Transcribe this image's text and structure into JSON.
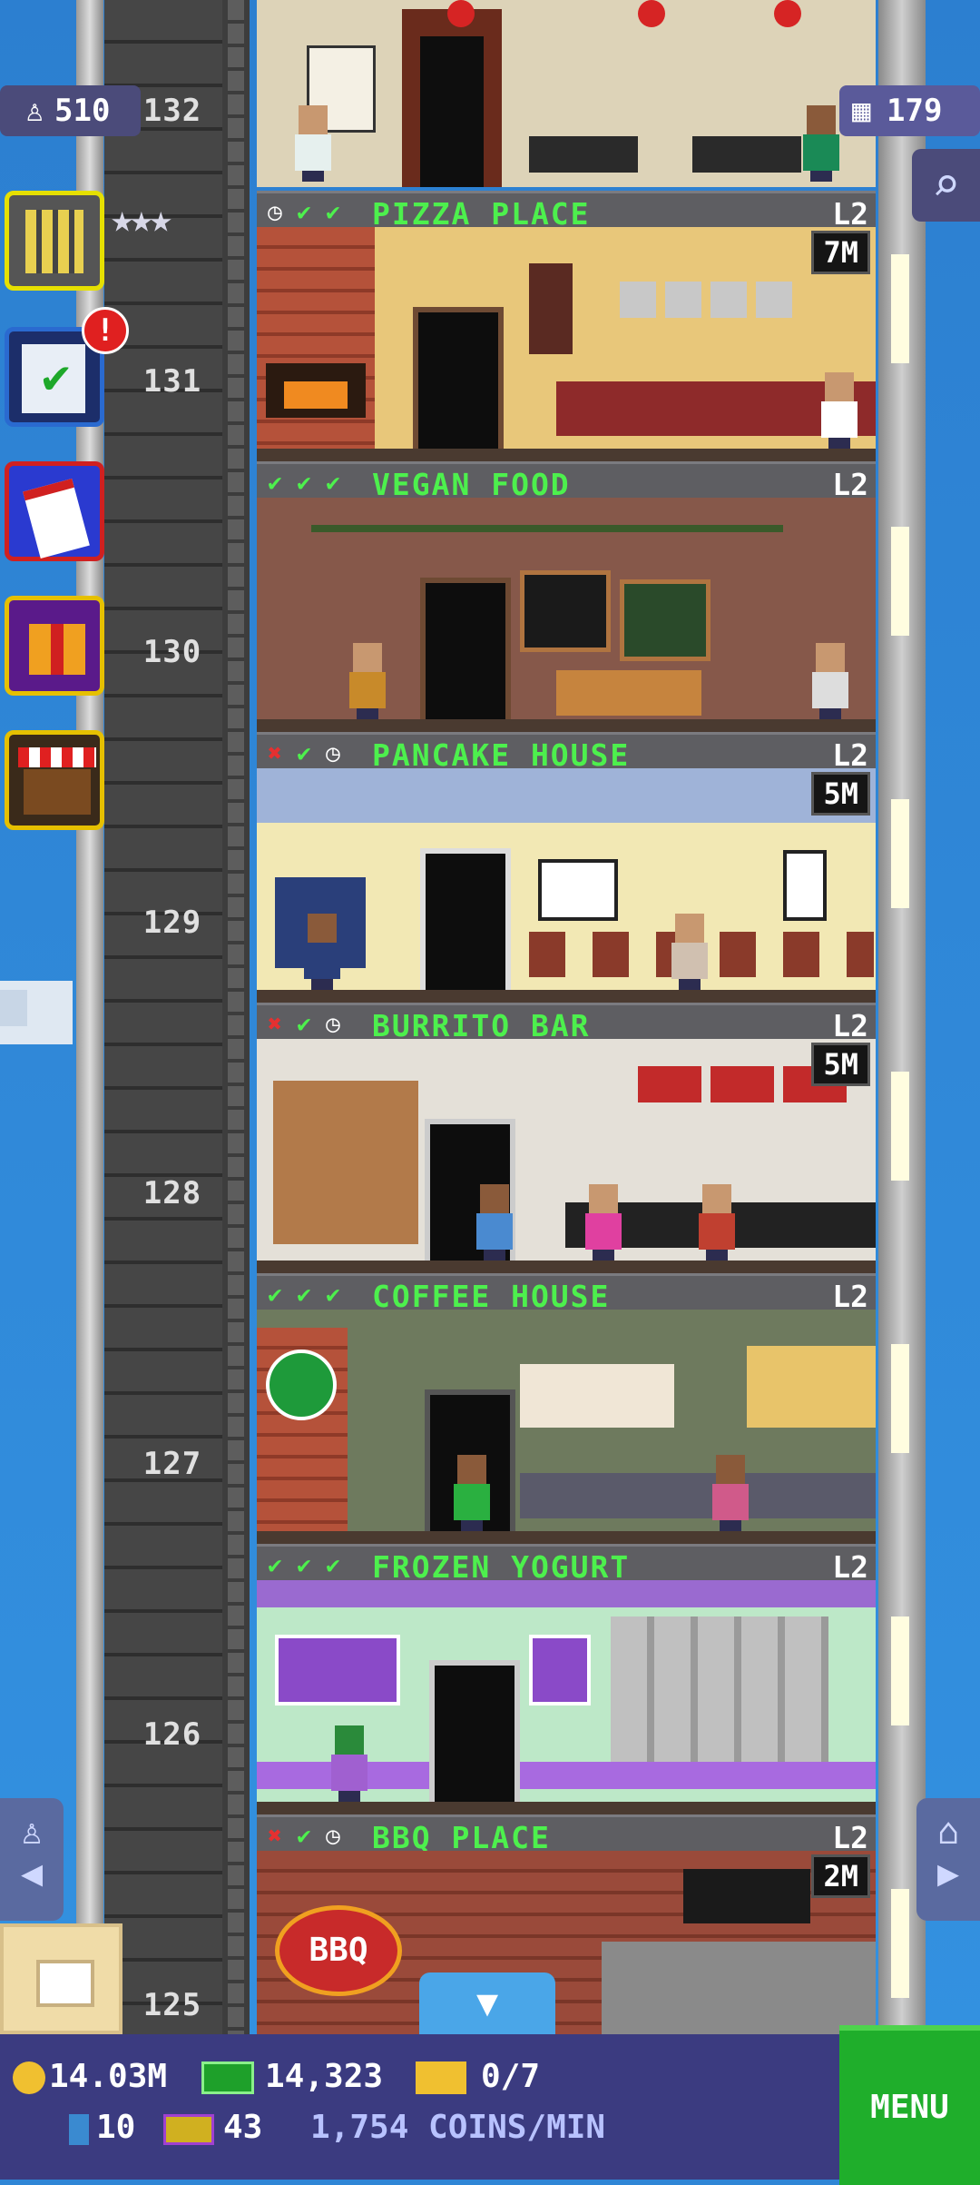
{
  "top": {
    "population": "510",
    "bitizen_count": "179"
  },
  "floors": [
    {
      "number": "132"
    },
    {
      "number": "131",
      "name": "PIZZA PLACE",
      "level": "L2",
      "price": "7M"
    },
    {
      "number": "130",
      "name": "VEGAN FOOD",
      "level": "L2"
    },
    {
      "number": "129",
      "name": "PANCAKE HOUSE",
      "level": "L2",
      "price": "5M"
    },
    {
      "number": "128",
      "name": "BURRITO BAR",
      "level": "L2",
      "price": "5M"
    },
    {
      "number": "127",
      "name": "COFFEE HOUSE",
      "level": "L2"
    },
    {
      "number": "126",
      "name": "FROZEN YOGURT",
      "level": "L2"
    },
    {
      "number": "125",
      "name": "BBQ PLACE",
      "level": "L2",
      "price": "2M"
    }
  ],
  "bottom": {
    "coins": "14.03M",
    "bux": "14,323",
    "tickets": "0/7",
    "keys": "10",
    "vip": "43",
    "rate": "1,754 COINS/MIN",
    "menu_label": "MENU"
  },
  "signs": {
    "bbq": "BBQ"
  },
  "colors": {
    "name_green": "#4df04d",
    "menu_green": "#1fae2b",
    "bar_bg": "#3b3b80"
  }
}
